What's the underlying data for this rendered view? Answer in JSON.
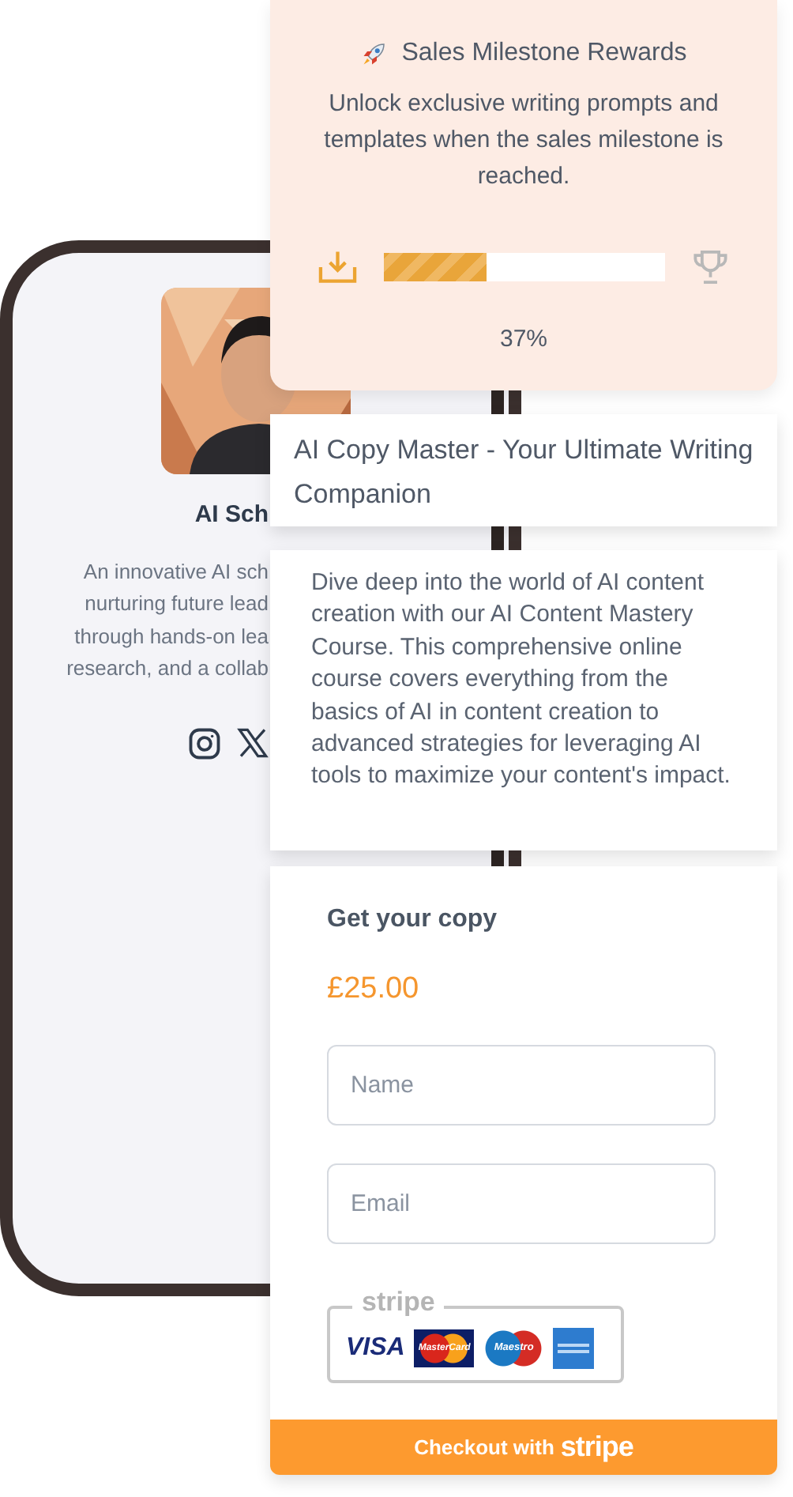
{
  "phone": {
    "name": "AI Sch",
    "bio_lines": [
      "An innovative AI sch",
      "nurturing future lead",
      "through hands-on lea",
      "research, and a collab"
    ]
  },
  "milestone": {
    "title": "Sales Milestone Rewards",
    "description": "Unlock exclusive writing prompts and templates when the sales milestone is reached.",
    "progress": {
      "level": 0.37,
      "reading": "37%"
    }
  },
  "product": {
    "title": "AI Copy Master - Your Ultimate Writing Companion",
    "description": "Dive deep into the world of AI content creation with our AI Content Mastery Course. This comprehensive online course covers everything from the basics of AI in content creation to advanced strategies for leveraging AI tools to maximize your content's impact."
  },
  "checkout": {
    "heading": "Get your copy",
    "price": "£25.00",
    "fields": [
      {
        "placeholder": "Name"
      },
      {
        "placeholder": "Email"
      }
    ],
    "payment_badge": {
      "legend": "stripe",
      "cards": [
        "VISA",
        "MasterCard",
        "Maestro"
      ]
    },
    "button": {
      "label": "Checkout with",
      "brand": "stripe"
    }
  }
}
